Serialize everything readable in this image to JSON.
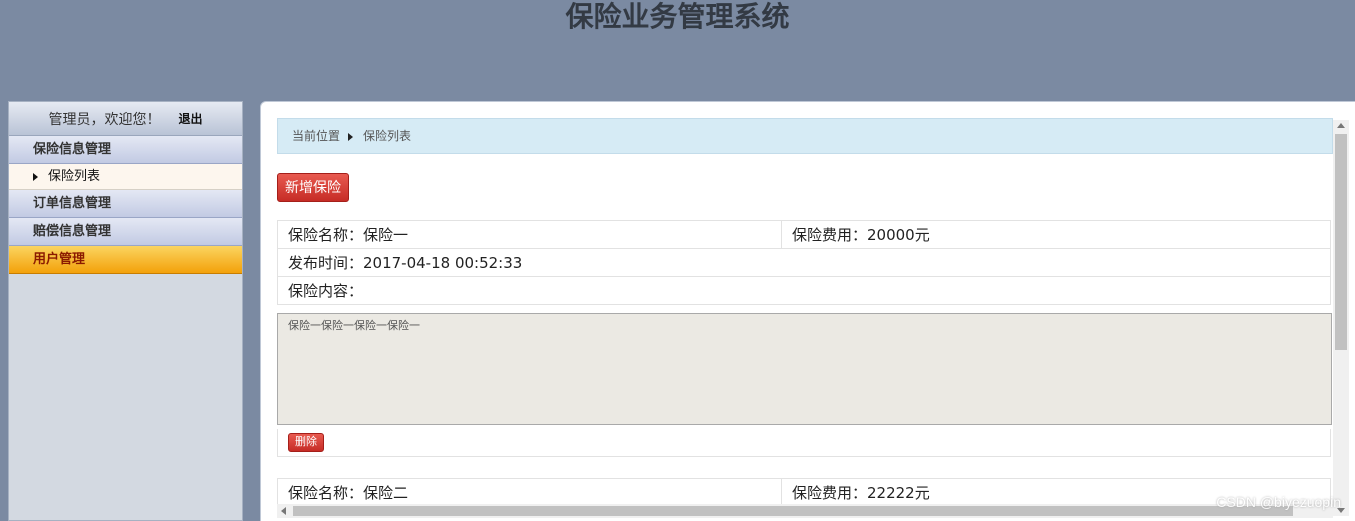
{
  "app": {
    "title": "保险业务管理系统"
  },
  "sidebar": {
    "welcome": "管理员，欢迎您！",
    "logout": "退出",
    "groups": [
      {
        "label": "保险信息管理"
      },
      {
        "label": "订单信息管理"
      },
      {
        "label": "赔偿信息管理"
      },
      {
        "label": "用户管理"
      }
    ],
    "sub_items": [
      {
        "label": "保险列表"
      }
    ]
  },
  "breadcrumb": {
    "current": "当前位置",
    "page": "保险列表"
  },
  "toolbar": {
    "add_label": "新增保险"
  },
  "records": [
    {
      "name": "保险名称：保险一",
      "fee": "保险费用：20000元",
      "time": "发布时间：2017-04-18 00:52:33",
      "content_label": "保险内容：",
      "content": "保险一保险一保险一保险一",
      "delete_label": "删除"
    },
    {
      "name": "保险名称：保险二",
      "fee": "保险费用：22222元"
    }
  ],
  "watermark": "CSDN @biyezuopin",
  "colors": {
    "active_nav": "#f3a10a",
    "button_red": "#c62c26",
    "breadcrumb_bg": "#d6ebf5"
  }
}
